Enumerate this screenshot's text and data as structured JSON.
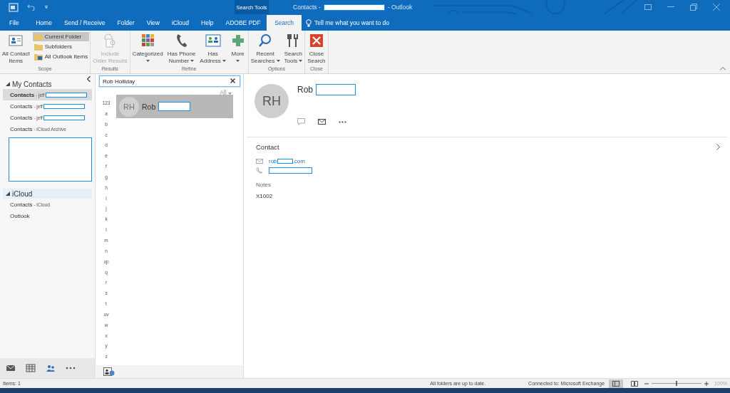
{
  "title_bar": {
    "contextual_label": "Search Tools",
    "title_prefix": "Contacts -",
    "title_suffix": "- Outlook"
  },
  "tabs": [
    {
      "label": "File",
      "selected": false
    },
    {
      "label": "Home",
      "selected": false
    },
    {
      "label": "Send / Receive",
      "selected": false
    },
    {
      "label": "Folder",
      "selected": false
    },
    {
      "label": "View",
      "selected": false
    },
    {
      "label": "iCloud",
      "selected": false
    },
    {
      "label": "Help",
      "selected": false
    },
    {
      "label": "ADOBE PDF",
      "selected": false
    },
    {
      "label": "Search",
      "selected": true
    }
  ],
  "tell_me": "Tell me what you want to do",
  "ribbon": {
    "groups": [
      {
        "label": "Scope",
        "buttons": [
          {
            "kind": "large",
            "lines": [
              "All Contact",
              "Items"
            ],
            "dropdown": false,
            "disabled": false
          },
          {
            "kind": "stack",
            "items": [
              {
                "label": "Current Folder",
                "selected": true
              },
              {
                "label": "Subfolders",
                "selected": false
              },
              {
                "label": "All Outlook Items",
                "selected": false
              }
            ]
          }
        ]
      },
      {
        "label": "Results",
        "buttons": [
          {
            "kind": "large",
            "lines": [
              "Include",
              "Older Results"
            ],
            "dropdown": false,
            "disabled": true
          }
        ]
      },
      {
        "label": "Refine",
        "buttons": [
          {
            "kind": "large",
            "lines": [
              "Categorized"
            ],
            "dropdown": true,
            "disabled": false
          },
          {
            "kind": "large",
            "lines": [
              "Has Phone",
              "Number"
            ],
            "dropdown": true,
            "disabled": false
          },
          {
            "kind": "large",
            "lines": [
              "Has",
              "Address"
            ],
            "dropdown": true,
            "disabled": false
          },
          {
            "kind": "large",
            "lines": [
              "More"
            ],
            "dropdown": true,
            "disabled": false
          }
        ]
      },
      {
        "label": "Options",
        "buttons": [
          {
            "kind": "large",
            "lines": [
              "Recent",
              "Searches"
            ],
            "dropdown": true,
            "disabled": false
          },
          {
            "kind": "large",
            "lines": [
              "Search",
              "Tools"
            ],
            "dropdown": true,
            "disabled": false
          }
        ]
      },
      {
        "label": "Close",
        "buttons": [
          {
            "kind": "large",
            "lines": [
              "Close",
              "Search"
            ],
            "dropdown": false,
            "disabled": false
          }
        ]
      }
    ]
  },
  "nav": {
    "groups": [
      {
        "label": "My Contacts",
        "expanded": true,
        "selected": false,
        "items": [
          {
            "name": "Contacts",
            "detail": "- jeff",
            "redacted": true,
            "selected": true
          },
          {
            "name": "Contacts",
            "detail": "- jeff",
            "redacted": true,
            "selected": false
          },
          {
            "name": "Contacts",
            "detail": "- jeff",
            "redacted": true,
            "selected": false
          },
          {
            "name": "Contacts",
            "detail": "- iCloud Archive",
            "redacted": false,
            "selected": false
          }
        ]
      },
      {
        "label": "iCloud",
        "expanded": true,
        "selected": true,
        "items": [
          {
            "name": "Contacts",
            "detail": "- iCloud",
            "redacted": false,
            "selected": false
          },
          {
            "name": "Outlook",
            "redacted": false,
            "selected": false
          }
        ]
      }
    ],
    "modules": [
      {
        "kind": "mail",
        "selected": false
      },
      {
        "kind": "calendar",
        "selected": false
      },
      {
        "kind": "people",
        "selected": true
      },
      {
        "kind": "more",
        "selected": false
      }
    ]
  },
  "list": {
    "search": {
      "value": "Rob Holliday"
    },
    "filter": "All",
    "index": [
      "123",
      "a",
      "b",
      "c",
      "d",
      "e",
      "f",
      "g",
      "h",
      "i",
      "j",
      "k",
      "l",
      "m",
      "n",
      "op",
      "q",
      "r",
      "s",
      "t",
      "uv",
      "w",
      "x",
      "y",
      "z"
    ],
    "contacts": [
      {
        "initials": "RH",
        "name": "Rob",
        "selected": true
      }
    ]
  },
  "reading": {
    "initials": "RH",
    "name": "Rob",
    "section": "Contact",
    "email_prefix": "rob",
    "email_suffix": ".com",
    "notes_label": "Notes",
    "notes": "X1002"
  },
  "status_bar": {
    "items": "Items: 1",
    "sync": "All folders are up to date.",
    "connection": "Connected to: Microsoft Exchange",
    "zoom": "100%",
    "level": 0.5
  }
}
